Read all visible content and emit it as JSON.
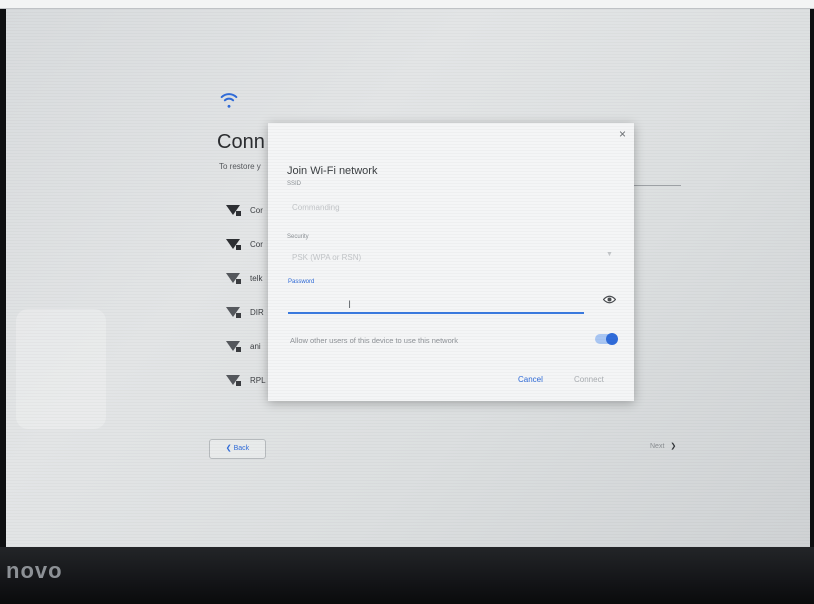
{
  "background_page": {
    "title": "Conn",
    "subtitle": "To restore y",
    "networks": [
      {
        "label": "Cor"
      },
      {
        "label": "Cor"
      },
      {
        "label": "telk"
      },
      {
        "label": "DIR"
      },
      {
        "label": "ani"
      },
      {
        "label": "RPL"
      }
    ],
    "back_label": "Back",
    "next_label": "Next"
  },
  "dialog": {
    "close_label": "×",
    "title": "Join Wi-Fi network",
    "ssid_label": "SSID",
    "ssid_value": "Commanding",
    "security_label": "Security",
    "security_value": "PSK (WPA or RSN)",
    "password_label": "Password",
    "password_value": "",
    "allow_text": "Allow other users of this device to use this network",
    "allow_enabled": true,
    "cancel_label": "Cancel",
    "connect_label": "Connect"
  },
  "bezel": {
    "brand": "novo"
  },
  "colors": {
    "accent": "#2f6bd9",
    "dialog_bg": "#f4f5f6"
  },
  "icons": [
    "wifi-icon",
    "wifi-lock-icon",
    "close-icon",
    "eye-icon",
    "chevron-left-icon",
    "chevron-right-icon",
    "text-cursor-icon"
  ]
}
